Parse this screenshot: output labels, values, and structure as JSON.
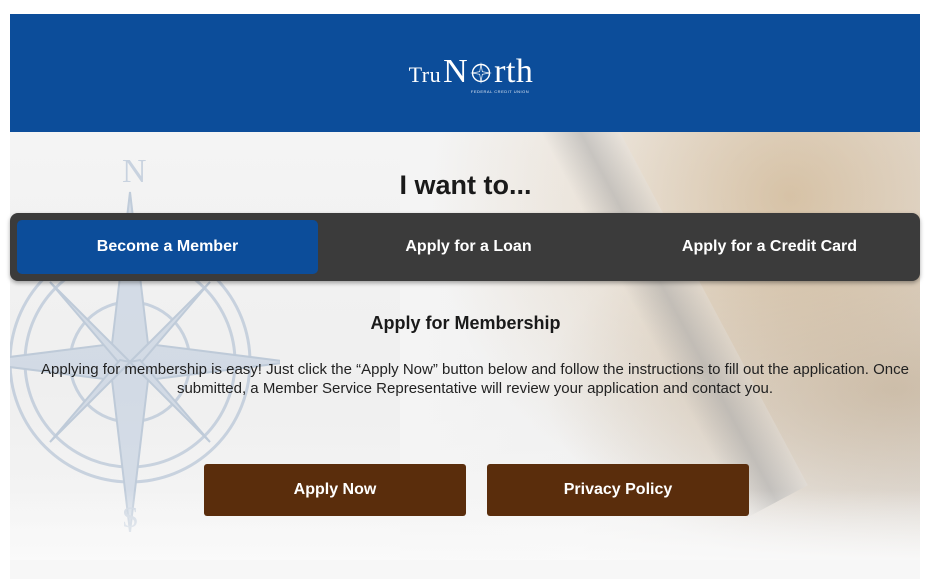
{
  "header": {
    "logo_small": "Tru",
    "logo_big": "N",
    "logo_tail": "rth",
    "logo_sub": "FEDERAL CREDIT UNION",
    "brand_color": "#0c4d9a"
  },
  "hero": {
    "title": "I want to..."
  },
  "tabs": [
    {
      "label": "Become a Member",
      "active": true
    },
    {
      "label": "Apply for a Loan",
      "active": false
    },
    {
      "label": "Apply for a Credit Card",
      "active": false
    }
  ],
  "section": {
    "heading": "Apply for Membership",
    "description": "Applying for membership is easy! Just click the “Apply Now” button below and follow the instructions to fill out the application. Once submitted, a Member Service Representative will review your application and contact you."
  },
  "buttons": {
    "apply_label": "Apply Now",
    "privacy_label": "Privacy Policy",
    "button_color": "#5a2d0c"
  },
  "icons": {
    "logo_star": "compass-star-icon",
    "background_compass": "compass-rose-icon"
  }
}
